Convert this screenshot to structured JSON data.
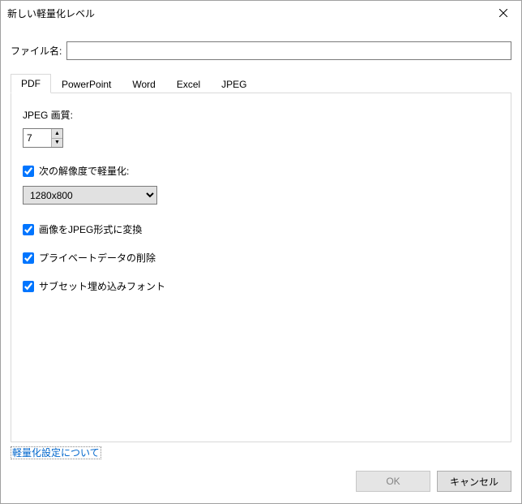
{
  "window": {
    "title": "新しい軽量化レベル"
  },
  "filename": {
    "label": "ファイル名:",
    "value": ""
  },
  "tabs": [
    {
      "label": "PDF"
    },
    {
      "label": "PowerPoint"
    },
    {
      "label": "Word"
    },
    {
      "label": "Excel"
    },
    {
      "label": "JPEG"
    }
  ],
  "pdf": {
    "jpeg_quality_label": "JPEG 画質:",
    "jpeg_quality_value": "7",
    "resolution_checkbox": "次の解像度で軽量化:",
    "resolution_value": "1280x800",
    "convert_jpeg": "画像をJPEG形式に変換",
    "remove_private": "プライベートデータの削除",
    "subset_fonts": "サブセット埋め込みフォント"
  },
  "link": {
    "about": "軽量化設定について"
  },
  "buttons": {
    "ok": "OK",
    "cancel": "キャンセル"
  }
}
